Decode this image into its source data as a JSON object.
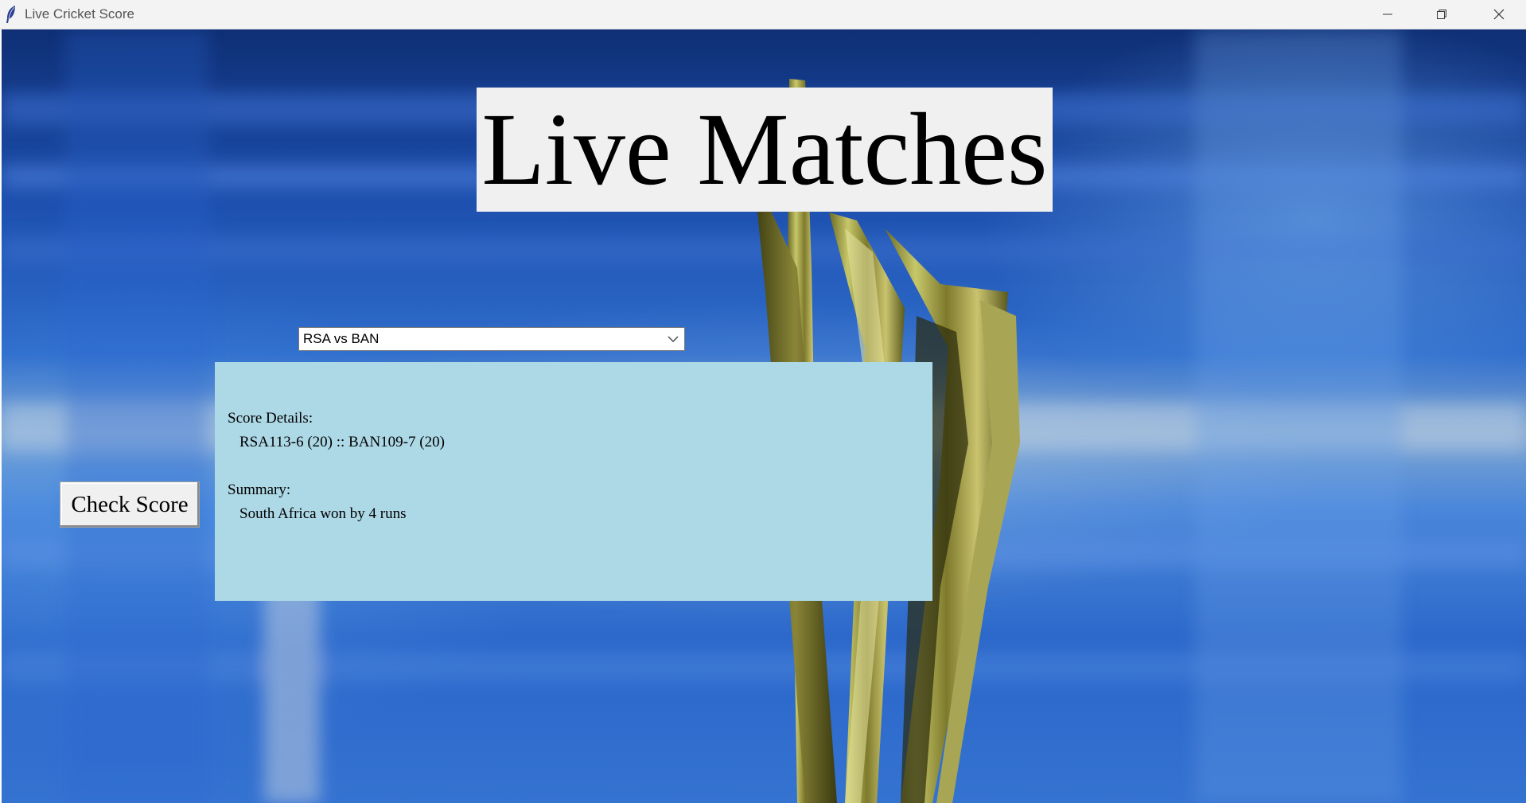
{
  "window": {
    "title": "Live Cricket Score",
    "controls": {
      "minimize": "minimize-icon",
      "maximize": "restore-icon",
      "close": "close-icon"
    }
  },
  "header": {
    "title": "Live Matches"
  },
  "match_select": {
    "value": "RSA vs BAN",
    "icon": "chevron-down-icon"
  },
  "score_panel": {
    "score_label": "Score Details:",
    "score_value": "RSA113-6 (20) :: BAN109-7 (20)",
    "summary_label": "Summary:",
    "summary_value": "South Africa won by 4 runs",
    "background_color": "#add8e6"
  },
  "actions": {
    "check_score_label": "Check Score"
  }
}
